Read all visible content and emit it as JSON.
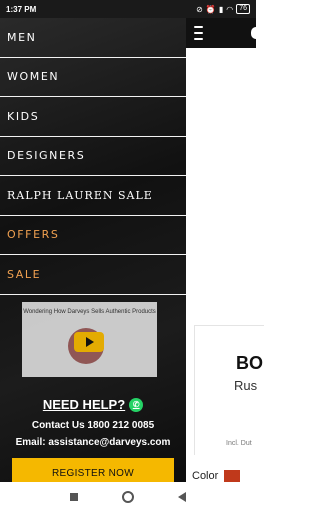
{
  "status": {
    "time": "1:37 PM",
    "battery": "76"
  },
  "drawer": {
    "items": [
      {
        "label": "MEN"
      },
      {
        "label": "WOMEN"
      },
      {
        "label": "KIDS"
      },
      {
        "label": "DESIGNERS"
      },
      {
        "label": "RALPH LAUREN SALE"
      },
      {
        "label": "OFFERS"
      },
      {
        "label": "SALE"
      }
    ],
    "video_text": "Wondering How Darveys Sells Authentic Products",
    "help_title": "NEED HELP?",
    "contact": "Contact Us 1800 212 0085",
    "email": "Email: assistance@darveys.com",
    "register_label": "REGISTER NOW"
  },
  "page": {
    "brand": "BO",
    "subname": "Rus",
    "duty": "Incl. Dut",
    "color_label": "Color"
  },
  "colors": {
    "accent": "#f0a050",
    "button": "#f5b800"
  }
}
